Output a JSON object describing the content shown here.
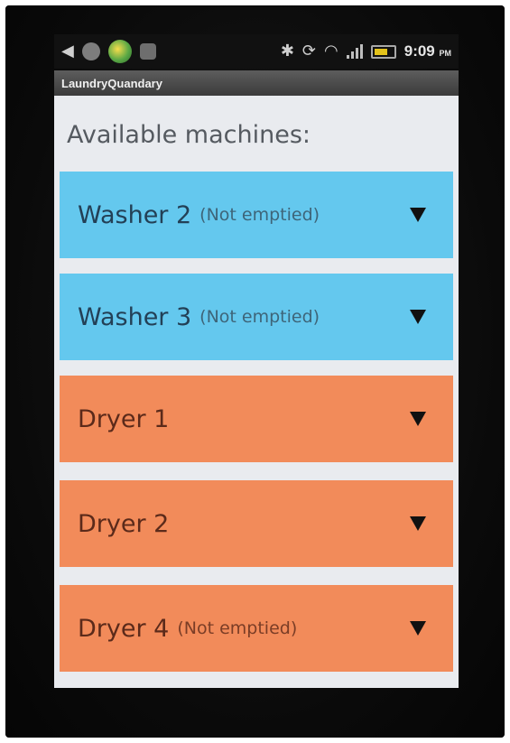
{
  "status_bar": {
    "time": "9:09",
    "ampm": "PM",
    "left_icons": [
      "notification-icon",
      "circle-icon",
      "globe-icon",
      "square-icon"
    ],
    "right_icons": [
      "bluetooth-icon",
      "sync-icon",
      "wifi-icon",
      "signal-icon",
      "battery-icon"
    ]
  },
  "app": {
    "title": "LaundryQuandary"
  },
  "main": {
    "heading": "Available machines:",
    "machines": [
      {
        "name": "Washer 2",
        "status": "(Not emptied)",
        "kind": "washer"
      },
      {
        "name": "Washer 3",
        "status": "(Not emptied)",
        "kind": "washer"
      },
      {
        "name": "Dryer 1",
        "status": "",
        "kind": "dryer"
      },
      {
        "name": "Dryer 2",
        "status": "",
        "kind": "dryer"
      },
      {
        "name": "Dryer 4",
        "status": "(Not emptied)",
        "kind": "dryer"
      }
    ]
  },
  "colors": {
    "washer": "#64c8ee",
    "dryer": "#f28b5a",
    "content_bg": "#e9ebef"
  }
}
